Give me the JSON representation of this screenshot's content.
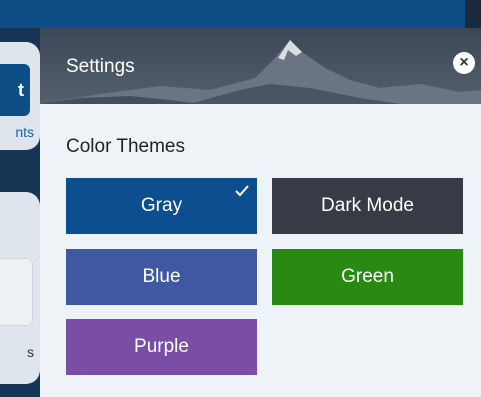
{
  "background_app": {
    "button_glyph": "t",
    "label_1": "nts",
    "label_2": "s"
  },
  "settings": {
    "title": "Settings",
    "close_icon": "close-icon",
    "section_title": "Color Themes",
    "themes": [
      {
        "label": "Gray",
        "color": "#0d4e8f",
        "selected": true
      },
      {
        "label": "Dark Mode",
        "color": "#373b45",
        "selected": false
      },
      {
        "label": "Blue",
        "color": "#3f58a0",
        "selected": false
      },
      {
        "label": "Green",
        "color": "#288a12",
        "selected": false
      },
      {
        "label": "Purple",
        "color": "#7b4ea5",
        "selected": false
      }
    ]
  },
  "colors": {
    "top_bar": "#0d4e86",
    "panel_bg": "#edf3f7"
  }
}
